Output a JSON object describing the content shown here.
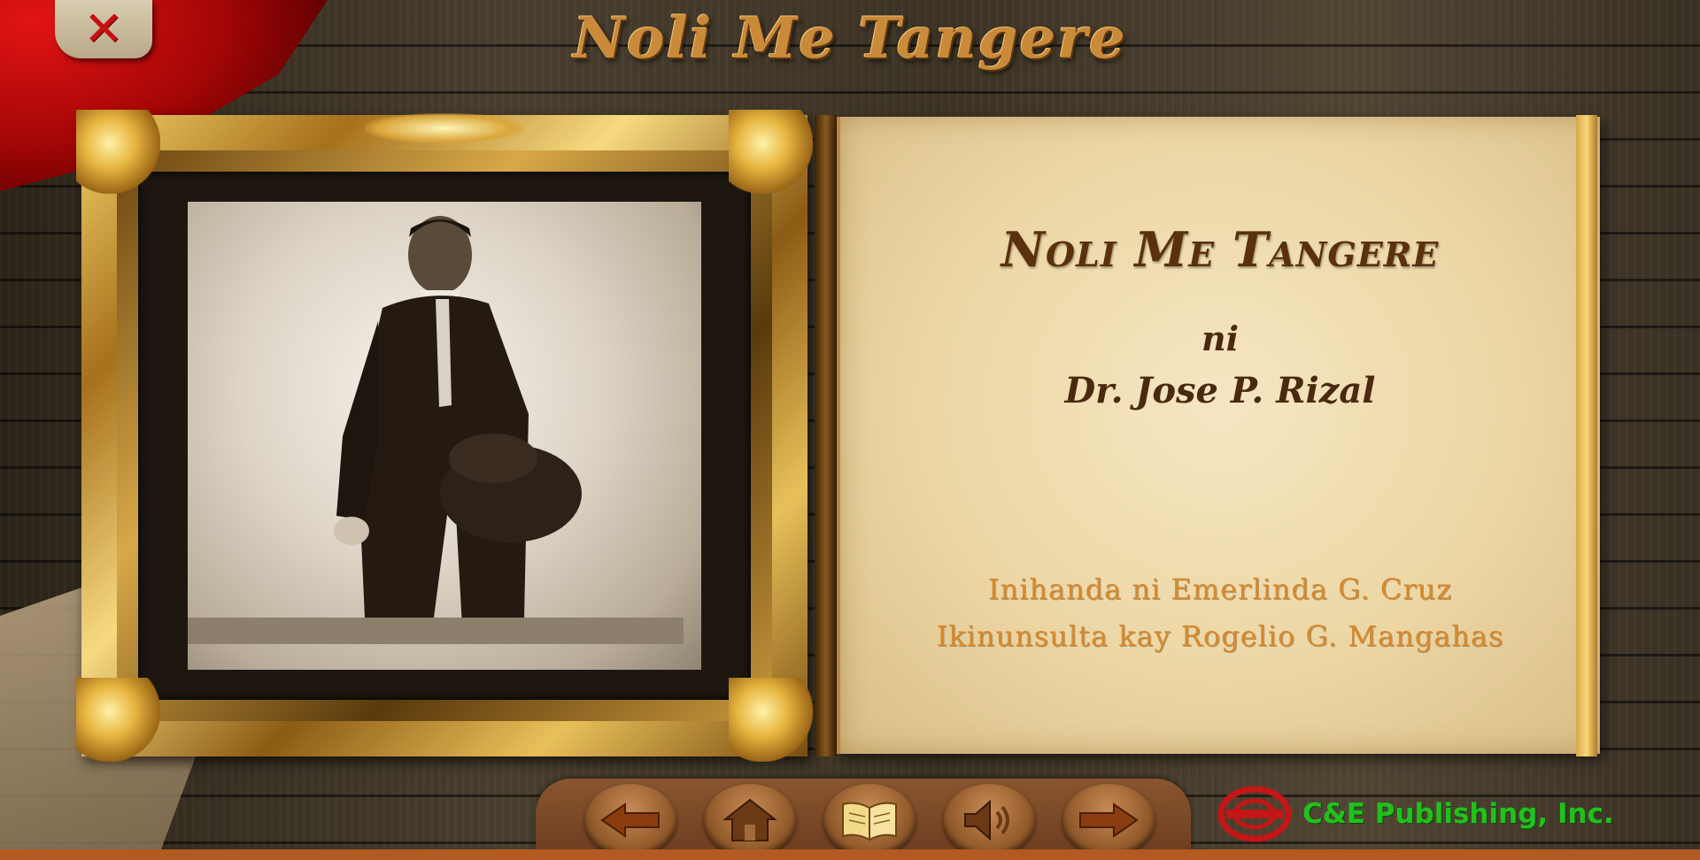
{
  "header": {
    "title": "Noli Me Tangere",
    "close_icon": "close-icon"
  },
  "book": {
    "title": "Noli Me Tangere",
    "ni": "ni",
    "author": "Dr. Jose P. Rizal",
    "prepared_by": "Inihanda ni Emerlinda G. Cruz",
    "consulted": "Ikinunsulta kay Rogelio G. Mangahas"
  },
  "portrait": {
    "icon": "portrait-image"
  },
  "nav": {
    "items": [
      {
        "name": "previous",
        "icon": "arrow-left-icon"
      },
      {
        "name": "home",
        "icon": "home-icon"
      },
      {
        "name": "book",
        "icon": "open-book-icon"
      },
      {
        "name": "sound",
        "icon": "speaker-icon"
      },
      {
        "name": "next",
        "icon": "arrow-right-icon"
      }
    ]
  },
  "publisher": {
    "name": "C&E Publishing, Inc.",
    "logo_icon": "publisher-logo-icon"
  },
  "colors": {
    "title_gold": "#c98a3a",
    "publisher_green": "#22c01c",
    "close_red": "#c81010"
  }
}
